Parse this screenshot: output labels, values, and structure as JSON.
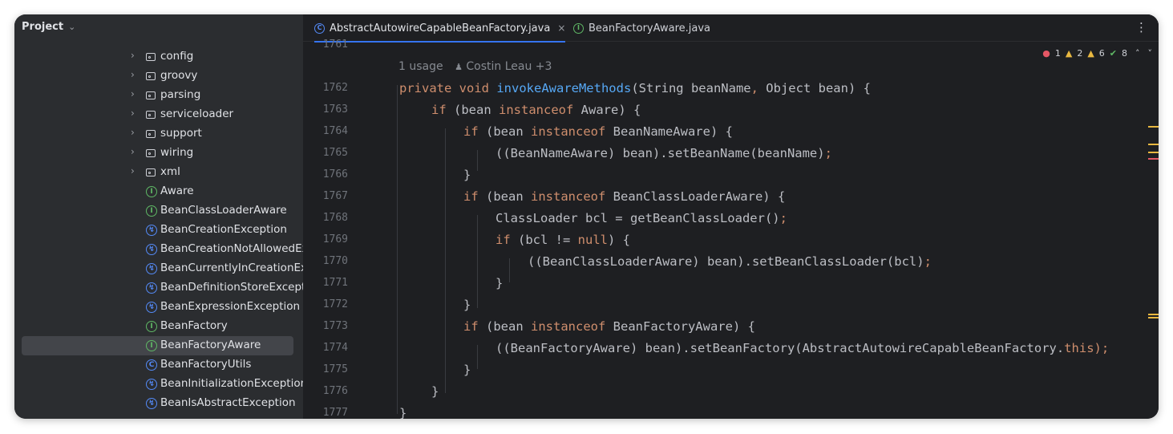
{
  "project_panel": {
    "title": "Project",
    "items": [
      {
        "label": "config",
        "kind": "folder"
      },
      {
        "label": "groovy",
        "kind": "folder"
      },
      {
        "label": "parsing",
        "kind": "folder"
      },
      {
        "label": "serviceloader",
        "kind": "folder"
      },
      {
        "label": "support",
        "kind": "folder"
      },
      {
        "label": "wiring",
        "kind": "folder"
      },
      {
        "label": "xml",
        "kind": "folder"
      },
      {
        "label": "Aware",
        "kind": "interface"
      },
      {
        "label": "BeanClassLoaderAware",
        "kind": "interface"
      },
      {
        "label": "BeanCreationException",
        "kind": "exception"
      },
      {
        "label": "BeanCreationNotAllowedExc",
        "kind": "exception"
      },
      {
        "label": "BeanCurrentlyInCreationExce",
        "kind": "exception"
      },
      {
        "label": "BeanDefinitionStoreExceptio",
        "kind": "exception"
      },
      {
        "label": "BeanExpressionException",
        "kind": "exception"
      },
      {
        "label": "BeanFactory",
        "kind": "interface"
      },
      {
        "label": "BeanFactoryAware",
        "kind": "interface",
        "selected": true
      },
      {
        "label": "BeanFactoryUtils",
        "kind": "class"
      },
      {
        "label": "BeanInitializationException",
        "kind": "exception"
      },
      {
        "label": "BeanIsAbstractException",
        "kind": "exception"
      }
    ]
  },
  "tabs": [
    {
      "label": "AbstractAutowireCapableBeanFactory.java",
      "active": true,
      "close": "×"
    },
    {
      "label": "BeanFactoryAware.java",
      "active": false
    }
  ],
  "inspections": {
    "errors": "1",
    "warnings": "2",
    "weak_warnings": "6",
    "typos": "8"
  },
  "editor": {
    "usage_hint": "1 usage",
    "author_hint": "Costin Leau +3",
    "line_numbers": [
      "1761",
      "1762",
      "1763",
      "1764",
      "1765",
      "1766",
      "1767",
      "1768",
      "1769",
      "1770",
      "1771",
      "1772",
      "1773",
      "1774",
      "1775",
      "1776",
      "1777"
    ]
  },
  "colors": {
    "accent": "#3574f0",
    "keyword": "#cf8e6d",
    "function": "#56a8f5",
    "text": "#bcbec4",
    "error": "#e55765",
    "warning": "#e9b841"
  }
}
